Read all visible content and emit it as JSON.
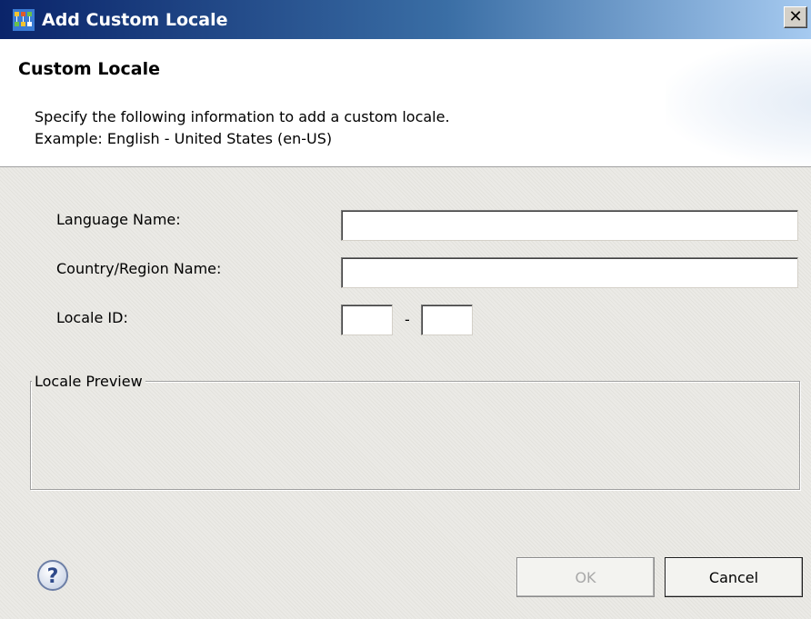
{
  "window": {
    "title": "Add Custom Locale",
    "close_symbol": "✕",
    "icon": "app-icon"
  },
  "header": {
    "title": "Custom Locale",
    "description_line1": "Specify the following information to add a custom locale.",
    "description_line2": "Example:   English - United States (en-US)"
  },
  "form": {
    "language_label": "Language Name:",
    "language_value": "",
    "country_label": "Country/Region Name:",
    "country_value": "",
    "locale_id_label": "Locale ID:",
    "locale_id_separator": "-",
    "locale_id_part1": "",
    "locale_id_part2": ""
  },
  "preview": {
    "legend": "Locale Preview",
    "content": ""
  },
  "footer": {
    "help_icon": "help-icon",
    "ok_label": "OK",
    "ok_enabled": false,
    "cancel_label": "Cancel"
  }
}
